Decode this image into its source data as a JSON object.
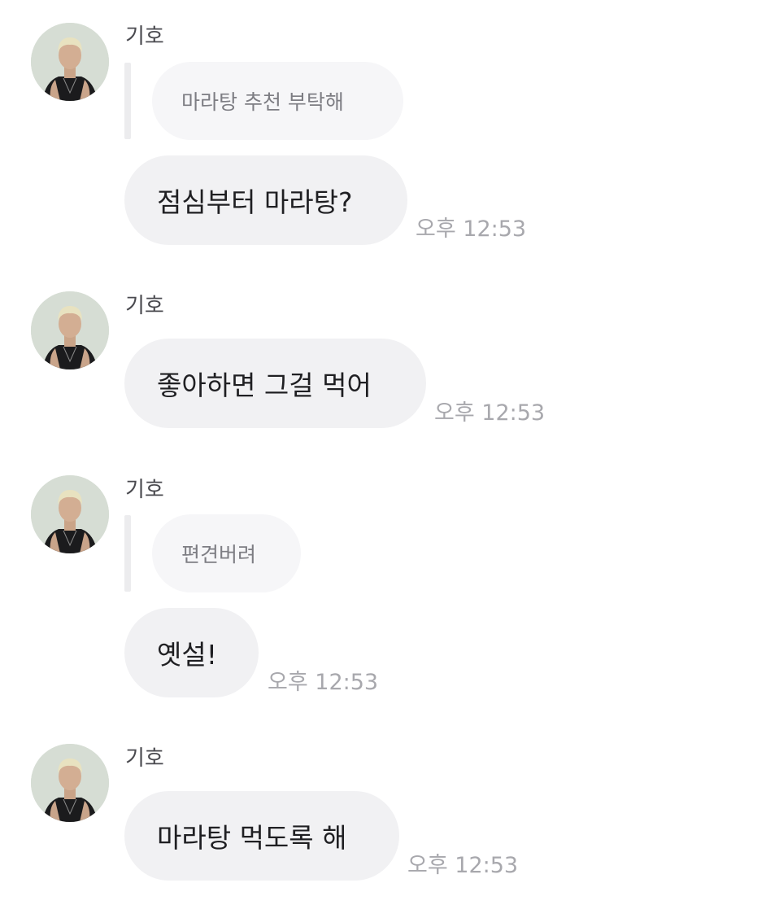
{
  "messages": [
    {
      "sender": "기호",
      "avatar_icon": "profile-photo-avatar",
      "reply_to": "마라탕 추천 부탁해",
      "text": "점심부터 마라탕?",
      "time": "오후 12:53"
    },
    {
      "sender": "기호",
      "avatar_icon": "profile-photo-avatar",
      "text": "좋아하면 그걸 먹어",
      "time": "오후 12:53"
    },
    {
      "sender": "기호",
      "avatar_icon": "profile-photo-avatar",
      "reply_to": "편견버려",
      "text": "옛설!",
      "time": "오후 12:53"
    },
    {
      "sender": "기호",
      "avatar_icon": "profile-photo-avatar",
      "text": "마라탕 먹도록 해",
      "time": "오후 12:53"
    }
  ],
  "colors": {
    "bubble_bg": "#f1f1f3",
    "reply_bg": "#f6f6f8",
    "time_text": "#a8a8ad"
  }
}
